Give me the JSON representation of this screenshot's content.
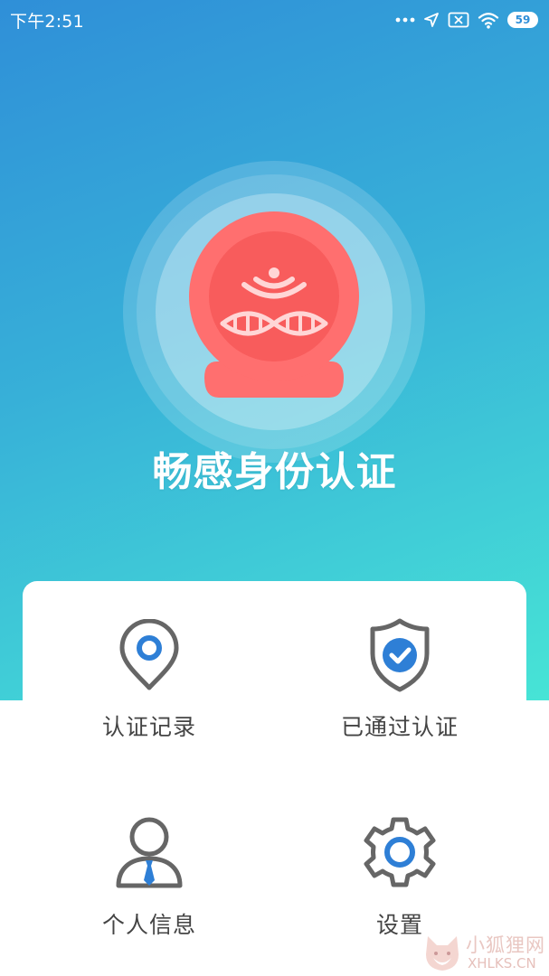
{
  "status_bar": {
    "time": "下午2:51",
    "battery": "59",
    "icons": [
      "more-dots-icon",
      "location-arrow-icon",
      "no-sim-icon",
      "wifi-icon",
      "battery-icon"
    ]
  },
  "hero": {
    "title": "畅感身份认证",
    "logo_icon": "dna-wifi-device-icon",
    "colors": {
      "gradient_start": "#2f8fd8",
      "gradient_end": "#47e4d6",
      "logo_red": "#ff6b6b"
    }
  },
  "menu": {
    "items": [
      {
        "label": "认证记录",
        "icon": "location-pin-icon"
      },
      {
        "label": "已通过认证",
        "icon": "shield-check-icon"
      },
      {
        "label": "个人信息",
        "icon": "person-tie-icon"
      },
      {
        "label": "设置",
        "icon": "gear-icon"
      }
    ],
    "colors": {
      "icon_gray": "#666666",
      "icon_blue": "#2e7fd6"
    }
  },
  "watermark": {
    "cn": "小狐狸网",
    "en": "XHLKS.CN"
  }
}
